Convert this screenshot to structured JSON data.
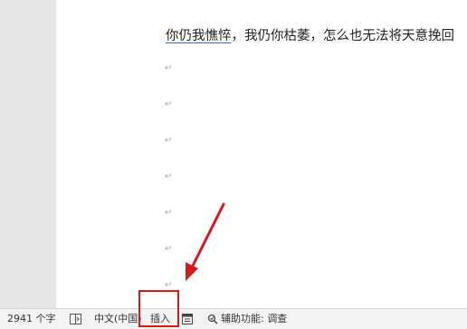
{
  "document": {
    "line_part1": "你仍我憔悴",
    "line_part2": "，我仍你枯萎，怎么也无法将天意挽回",
    "paragraph_mark": "↵"
  },
  "statusbar": {
    "word_count": "2941 个字",
    "language": "中文(中国)",
    "insert_mode": "插入",
    "accessibility": "辅助功能: 调查"
  },
  "annotation": {
    "color": "#d61a1a"
  }
}
